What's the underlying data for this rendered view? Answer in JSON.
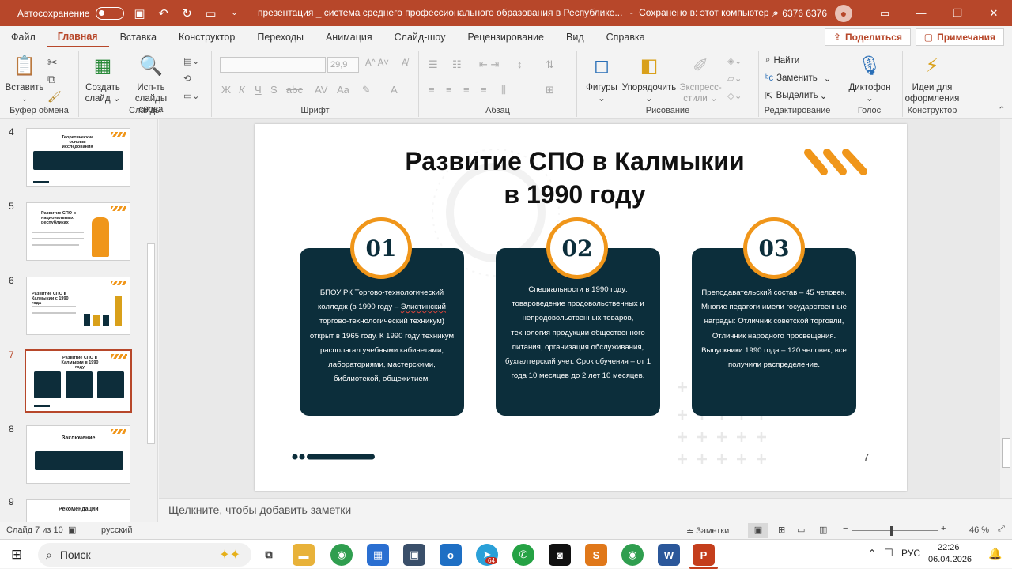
{
  "titlebar": {
    "autosave_label": "Автосохранение",
    "doc_title": "презентация _ система среднего профессионального образования в Республике...",
    "save_status": "Сохранено в: этот компьютер",
    "user_name": "6376 6376"
  },
  "menu": {
    "tabs": [
      "Файл",
      "Главная",
      "Вставка",
      "Конструктор",
      "Переходы",
      "Анимация",
      "Слайд-шоу",
      "Рецензирование",
      "Вид",
      "Справка"
    ],
    "share_label": "Поделиться",
    "comments_label": "Примечания"
  },
  "ribbon": {
    "clipboard": {
      "paste": "Вставить",
      "label": "Буфер обмена"
    },
    "slides": {
      "new_slide_1": "Создать",
      "new_slide_2": "слайд",
      "reuse_1": "Исп-ть",
      "reuse_2": "слайды снова",
      "label": "Слайды"
    },
    "font": {
      "size": "29,9",
      "label": "Шрифт"
    },
    "paragraph": {
      "label": "Абзац"
    },
    "drawing": {
      "shapes": "Фигуры",
      "arrange": "Упорядочить",
      "styles_1": "Экспресс-",
      "styles_2": "стили",
      "label": "Рисование"
    },
    "editing": {
      "find": "Найти",
      "replace": "Заменить",
      "select": "Выделить",
      "label": "Редактирование"
    },
    "voice": {
      "dictate": "Диктофон",
      "label": "Голос"
    },
    "designer": {
      "ideas_1": "Идеи для",
      "ideas_2": "оформления",
      "label": "Конструктор"
    }
  },
  "thumbnails": {
    "numbers": [
      "4",
      "5",
      "6",
      "7",
      "8",
      "9"
    ],
    "titles": [
      "Теоретические основы исследования",
      "Развитие СПО в национальных республиках",
      "Развитие СПО в Калмыкии с 1990 года",
      "Развитие СПО в Калмыкии в 1990 году",
      "Заключение",
      "Рекомендации"
    ]
  },
  "slide": {
    "title": "Развитие СПО в Калмыкии в 1990 году",
    "page_number": "7",
    "cards": [
      {
        "num": "01",
        "text_before": "БПОУ РК Торгово-технологический колледж (в 1990 году – ",
        "text_underlined": "Элистинский",
        "text_after": " торгово-технологический техникум) открыт в 1965 году. К 1990 году техникум располагал учебными кабинетами, лабораториями, мастерскими, библиотекой, общежитием."
      },
      {
        "num": "02",
        "text": "Специальности в 1990 году: товароведение продовольственных и непродовольственных товаров, технология продукции общественного питания, организация обслуживания, бухгалтерский учет. Срок обучения – от 1 года 10 месяцев до 2 лет 10 месяцев."
      },
      {
        "num": "03",
        "text": "Преподавательский состав – 45 человек. Многие педагоги имели государственные награды: Отличник советской торговли, Отличник народного просвещения. Выпускники 1990 года – 120 человек, все получили распределение."
      }
    ]
  },
  "notes_placeholder": "Щелкните, чтобы добавить заметки",
  "status": {
    "slide_count": "Слайд 7 из 10",
    "language": "русский",
    "notes_label": "Заметки",
    "zoom": "46 %"
  },
  "taskbar": {
    "search": "Поиск",
    "lang": "РУС",
    "time": "22:26",
    "date": "06.04.2026",
    "telegram_badge": "64"
  },
  "colors": {
    "accent": "#b7472a",
    "card": "#0c2e3b",
    "orange": "#f0961a"
  }
}
